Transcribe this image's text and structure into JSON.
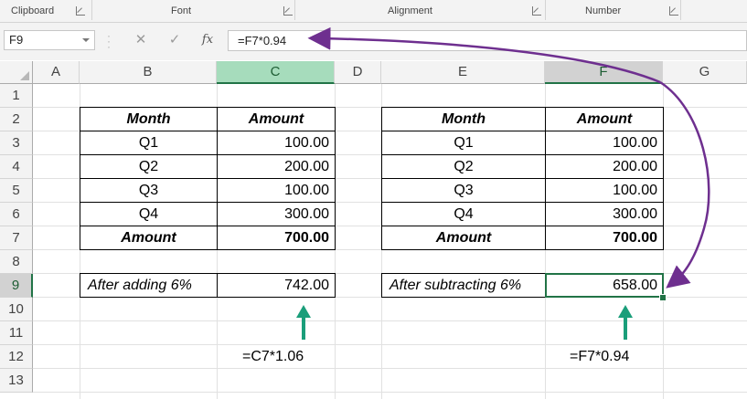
{
  "ribbon": {
    "groups": [
      "Clipboard",
      "Font",
      "Alignment",
      "Number"
    ]
  },
  "formula_bar": {
    "name_box": "F9",
    "cancel_glyph": "✕",
    "enter_glyph": "✓",
    "fx_label": "fx",
    "formula": "=F7*0.94"
  },
  "columns": [
    "A",
    "B",
    "C",
    "D",
    "E",
    "F",
    "G"
  ],
  "rows": [
    "1",
    "2",
    "3",
    "4",
    "5",
    "6",
    "7",
    "8",
    "9",
    "10",
    "11",
    "12",
    "13"
  ],
  "table_left": {
    "header": [
      "Month",
      "Amount"
    ],
    "rows": [
      [
        "Q1",
        "100.00"
      ],
      [
        "Q2",
        "200.00"
      ],
      [
        "Q3",
        "100.00"
      ],
      [
        "Q4",
        "300.00"
      ]
    ],
    "total": [
      "Amount",
      "700.00"
    ],
    "adjust_label": "After adding 6%",
    "adjust_value": "742.00",
    "formula_note": "=C7*1.06"
  },
  "table_right": {
    "header": [
      "Month",
      "Amount"
    ],
    "rows": [
      [
        "Q1",
        "100.00"
      ],
      [
        "Q2",
        "200.00"
      ],
      [
        "Q3",
        "100.00"
      ],
      [
        "Q4",
        "300.00"
      ]
    ],
    "total": [
      "Amount",
      "700.00"
    ],
    "adjust_label": "After subtracting 6%",
    "adjust_value": "658.00",
    "formula_note": "=F7*0.94"
  },
  "selection": {
    "active_cell": "F9",
    "accent": "#217346"
  },
  "annotation_colors": {
    "up_arrows": "#1a9e7a",
    "curved_arrow": "#6e2f8f"
  }
}
